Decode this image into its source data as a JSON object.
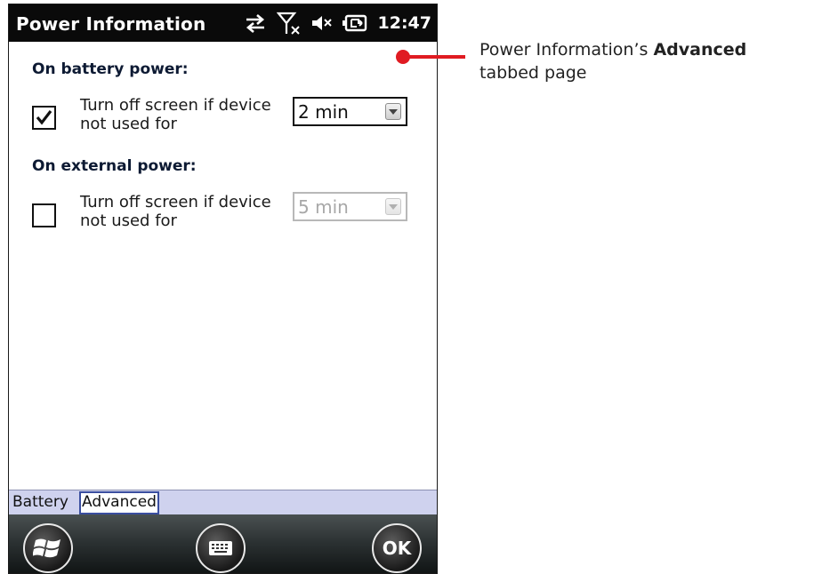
{
  "titlebar": {
    "title": "Power Information",
    "clock": "12:47",
    "icons": [
      "sync-arrows-icon",
      "no-signal-icon",
      "speaker-muted-icon",
      "battery-charging-icon"
    ]
  },
  "battery_section": {
    "heading": "On battery power:",
    "checked": true,
    "label": "Turn off screen if device not used for",
    "timeout_value": "2 min"
  },
  "external_section": {
    "heading": "On external power:",
    "checked": false,
    "label": "Turn off screen if device not used for",
    "timeout_value": "5 min"
  },
  "tabs": [
    {
      "label": "Battery",
      "active": false
    },
    {
      "label": "Advanced",
      "active": true
    }
  ],
  "softkeys": {
    "start": "windows-logo-icon",
    "keyboard": "keyboard-icon",
    "ok_label": "OK"
  },
  "annotation": {
    "prefix": "Power Information’s ",
    "bold": "Advanced",
    "suffix": "tabbed page",
    "color": "#e01b22"
  }
}
